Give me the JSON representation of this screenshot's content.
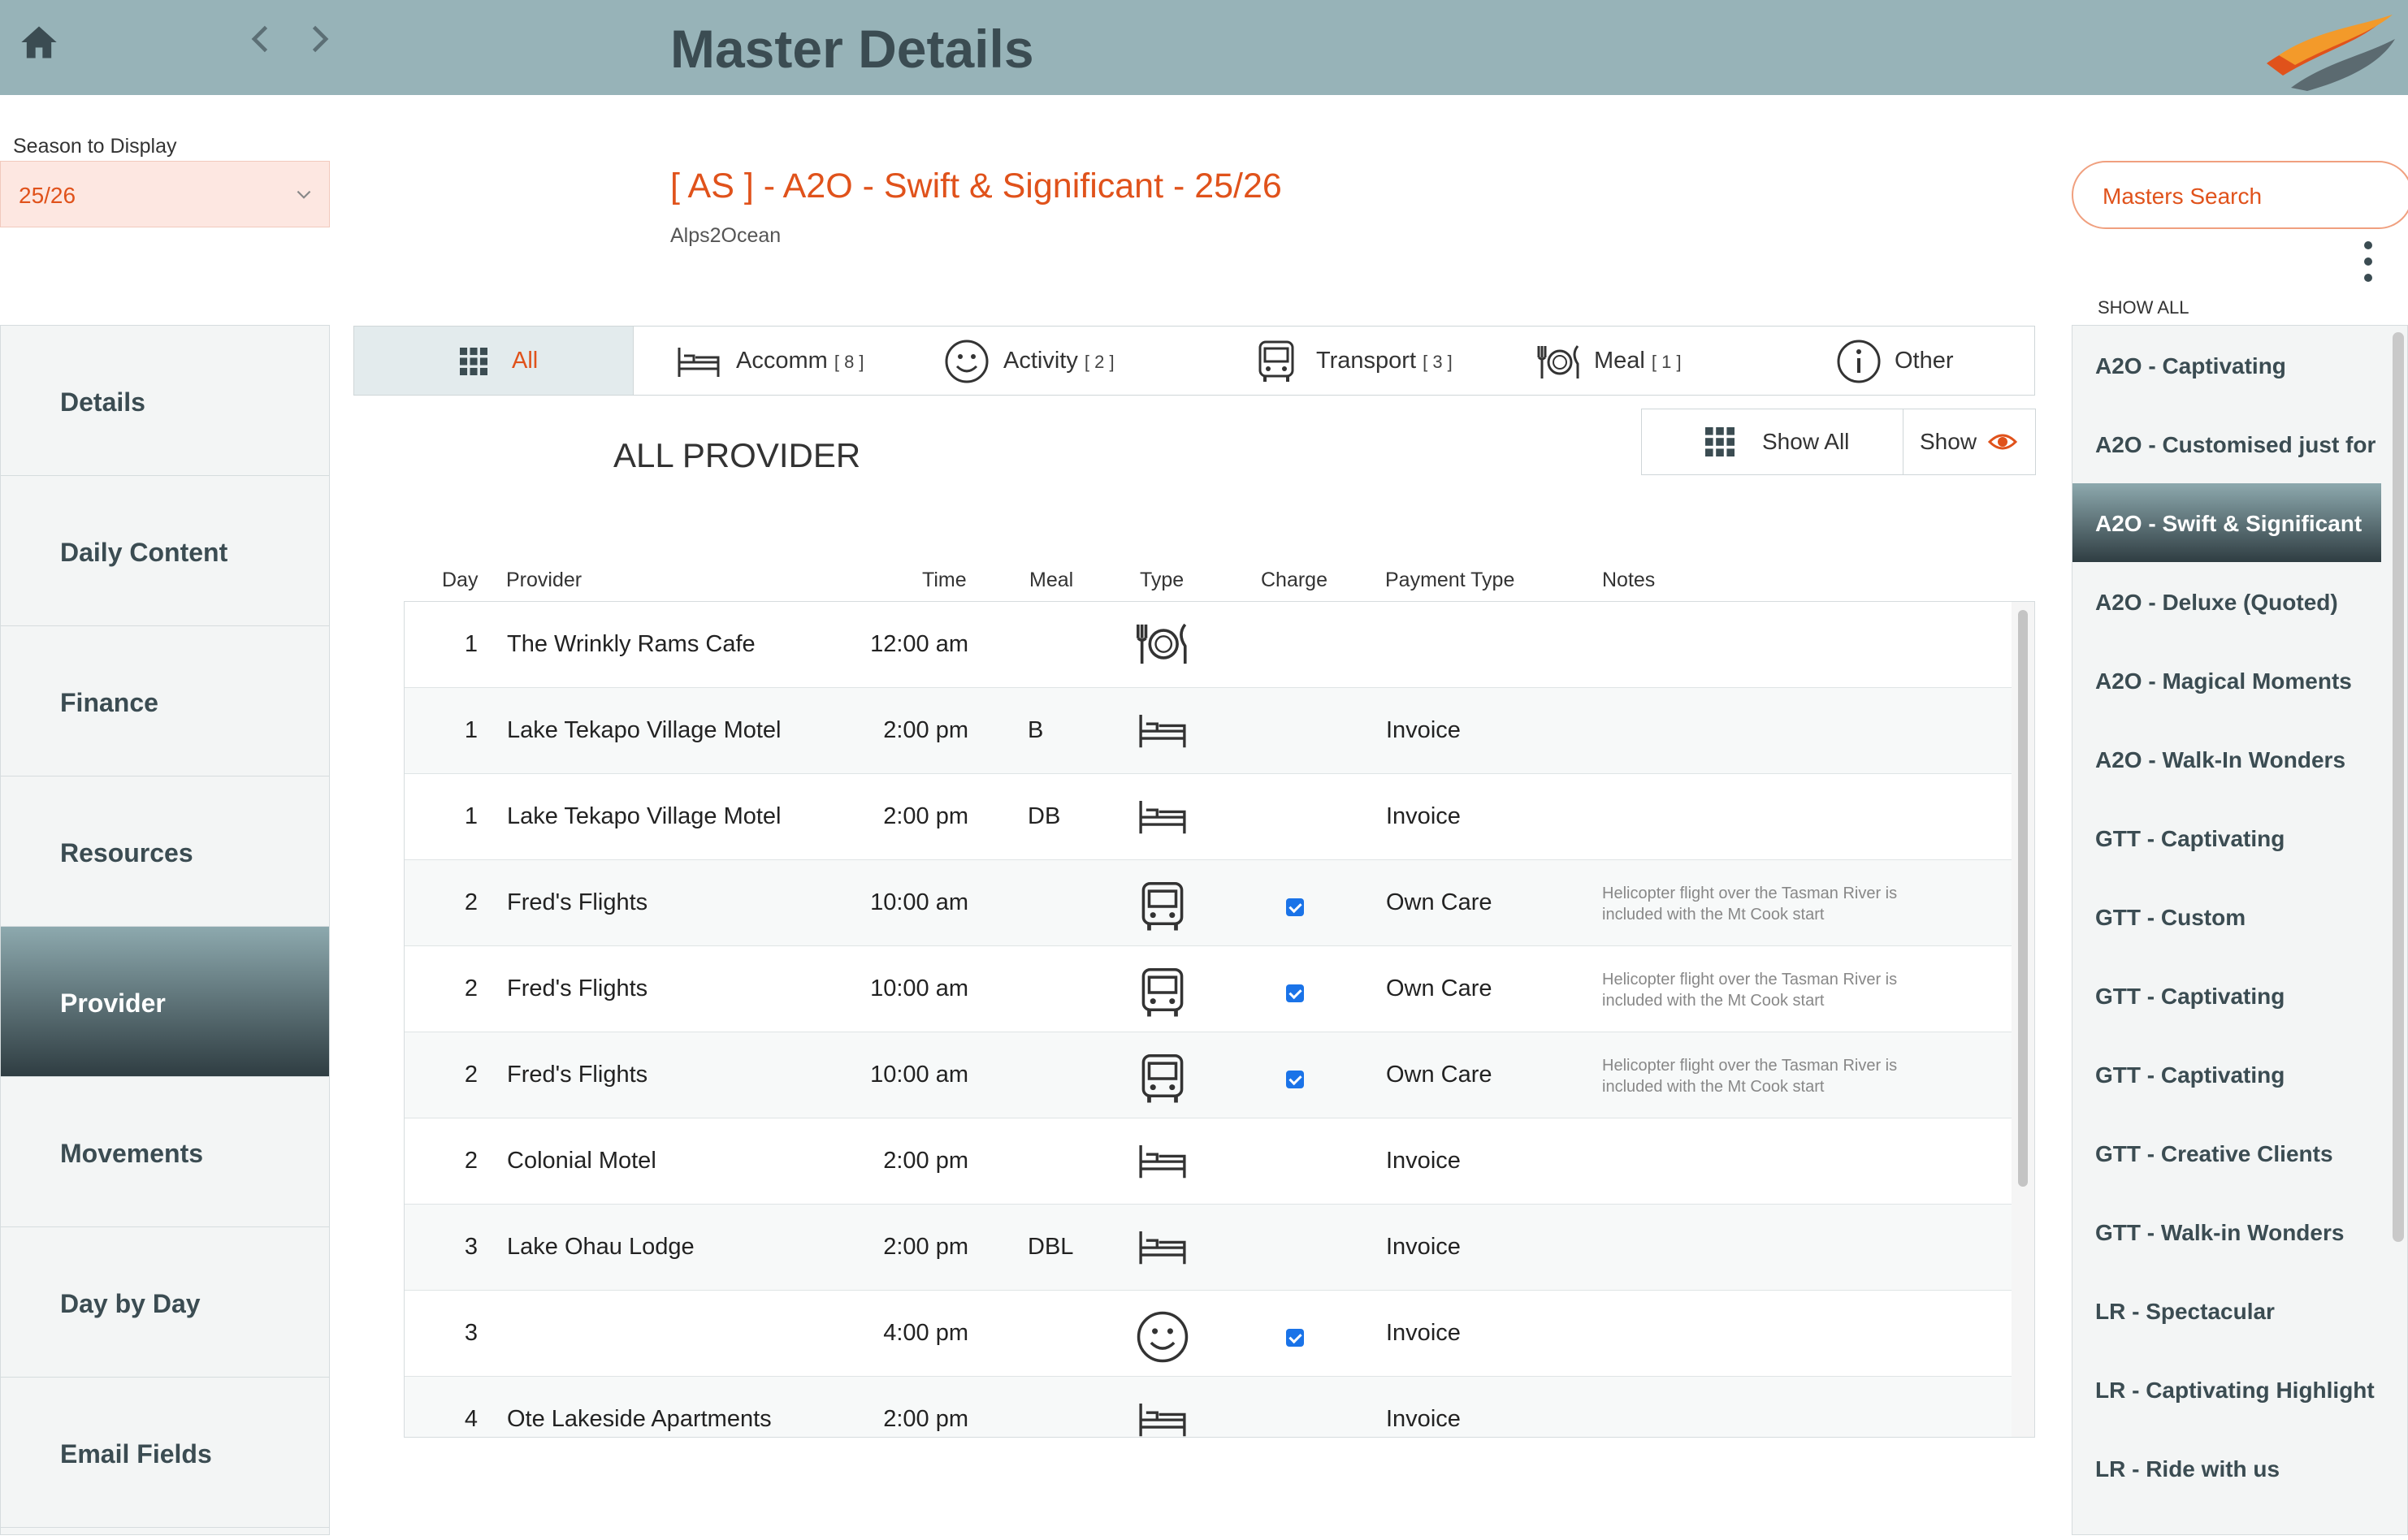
{
  "header": {
    "title": "Master Details"
  },
  "season": {
    "label": "Season to Display",
    "value": "25/26"
  },
  "master": {
    "title": "[ AS ] - A2O - Swift & Significant - 25/26",
    "subtitle": "Alps2Ocean"
  },
  "search": {
    "label": "Masters Search"
  },
  "right_panel": {
    "show_all": "SHOW ALL",
    "items": [
      "A2O - Captivating",
      "A2O - Customised just for",
      "A2O - Swift & Significant",
      "A2O - Deluxe (Quoted)",
      "A2O - Magical Moments",
      "A2O - Walk-In Wonders",
      "GTT - Captivating",
      "GTT - Custom",
      "GTT - Captivating",
      "GTT - Captivating",
      "GTT - Creative Clients",
      "GTT - Walk-in Wonders",
      "LR - Spectacular",
      "LR - Captivating Highlight",
      "LR - Ride with us"
    ]
  },
  "sidebar": {
    "items": [
      "Details",
      "Daily Content",
      "Finance",
      "Resources",
      "Provider",
      "Movements",
      "Day by Day",
      "Email Fields"
    ]
  },
  "tabs": [
    {
      "label": "All",
      "count": ""
    },
    {
      "label": "Accomm",
      "count": "[ 8 ]"
    },
    {
      "label": "Activity",
      "count": "[ 2 ]"
    },
    {
      "label": "Transport",
      "count": "[ 3 ]"
    },
    {
      "label": "Meal",
      "count": "[ 1 ]"
    },
    {
      "label": "Other",
      "count": ""
    }
  ],
  "section": {
    "title": "ALL PROVIDER"
  },
  "filters": {
    "show_all": "Show All",
    "show": "Show"
  },
  "table": {
    "headers": {
      "day": "Day",
      "provider": "Provider",
      "time": "Time",
      "meal": "Meal",
      "type": "Type",
      "charge": "Charge",
      "payment": "Payment Type",
      "notes": "Notes"
    },
    "rows": [
      {
        "day": "1",
        "provider": "The Wrinkly Rams Cafe",
        "time": "12:00 am",
        "meal": "",
        "type": "meal-icon",
        "charge": false,
        "payment": "",
        "notes": ""
      },
      {
        "day": "1",
        "provider": "Lake Tekapo Village Motel",
        "time": "2:00 pm",
        "meal": "B",
        "type": "bed-icon",
        "charge": false,
        "payment": "Invoice",
        "notes": ""
      },
      {
        "day": "1",
        "provider": "Lake Tekapo Village Motel",
        "time": "2:00 pm",
        "meal": "DB",
        "type": "bed-icon",
        "charge": false,
        "payment": "Invoice",
        "notes": ""
      },
      {
        "day": "2",
        "provider": "Fred's Flights",
        "time": "10:00 am",
        "meal": "",
        "type": "bus-icon",
        "charge": true,
        "payment": "Own Care",
        "notes": "Helicopter flight over the Tasman River is included with the Mt Cook start"
      },
      {
        "day": "2",
        "provider": "Fred's Flights",
        "time": "10:00 am",
        "meal": "",
        "type": "bus-icon",
        "charge": true,
        "payment": "Own Care",
        "notes": "Helicopter flight over the Tasman River is included with the Mt Cook start"
      },
      {
        "day": "2",
        "provider": "Fred's Flights",
        "time": "10:00 am",
        "meal": "",
        "type": "bus-icon",
        "charge": true,
        "payment": "Own Care",
        "notes": "Helicopter flight over the Tasman River is included with the Mt Cook start"
      },
      {
        "day": "2",
        "provider": "Colonial Motel",
        "time": "2:00 pm",
        "meal": "",
        "type": "bed-icon",
        "charge": false,
        "payment": "Invoice",
        "notes": ""
      },
      {
        "day": "3",
        "provider": "Lake Ohau Lodge",
        "time": "2:00 pm",
        "meal": "DBL",
        "type": "bed-icon",
        "charge": false,
        "payment": "Invoice",
        "notes": ""
      },
      {
        "day": "3",
        "provider": "",
        "time": "4:00 pm",
        "meal": "",
        "type": "smiley-icon",
        "charge": true,
        "payment": "Invoice",
        "notes": ""
      },
      {
        "day": "4",
        "provider": "Ote Lakeside Apartments",
        "time": "2:00 pm",
        "meal": "",
        "type": "bed-icon",
        "charge": false,
        "payment": "Invoice",
        "notes": ""
      }
    ]
  },
  "colors": {
    "header_bg": "#97b3b8",
    "accent": "#e0521b",
    "active_gradient_top": "#8da9ae",
    "active_gradient_bottom": "#2f3d42",
    "season_bg": "#fde7e1"
  }
}
